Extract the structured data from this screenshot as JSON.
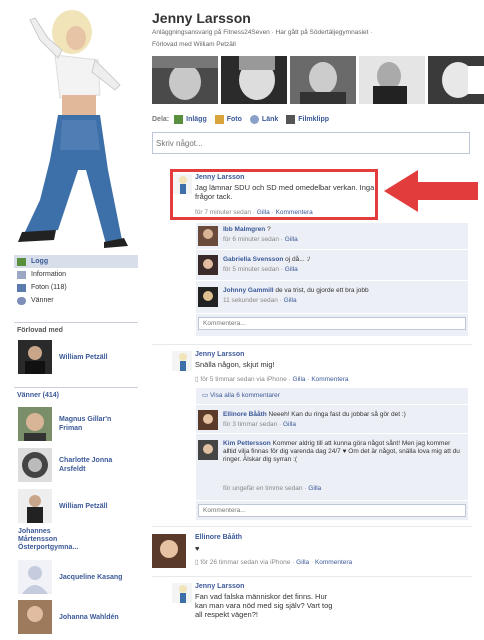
{
  "profile": {
    "name": "Jenny Larsson",
    "info_line": "Anläggningsansvarig på Fitness24Seven · Har gått på Södertäljegymnasiet ·",
    "engaged_line": "Förlovad med William Petzäll"
  },
  "nav": [
    {
      "label": "Logg",
      "icon": "wall-icon"
    },
    {
      "label": "Information",
      "icon": "info-icon"
    },
    {
      "label": "Foton (118)",
      "icon": "photos-icon"
    },
    {
      "label": "Vänner",
      "icon": "friends-icon"
    }
  ],
  "engaged_heading": "Förlovad med",
  "engaged_friend": "William Petzäll",
  "friends_heading": "Vänner (414)",
  "friends": [
    {
      "name": "Magnus Gillar'n Friman"
    },
    {
      "name": "Charlotte Jonna Arsfeldt"
    },
    {
      "name": "William Petzäll"
    },
    {
      "name": "Johannes Mårtensson Österportgymna..."
    },
    {
      "name": "Jacqueline Kasang"
    },
    {
      "name": "Johanna Wahldén"
    }
  ],
  "composer": {
    "label": "Dela:",
    "options": [
      "Inlägg",
      "Foto",
      "Länk",
      "Filmklipp"
    ],
    "placeholder": "Skriv något..."
  },
  "posts": [
    {
      "author": "Jenny Larsson",
      "text": "Jag lämnar SDU och SD med omedelbar verkan. Inga frågor tack.",
      "time": "för 7 minuter sedan · ",
      "actions": [
        "Gilla",
        "Kommentera"
      ],
      "comments": [
        {
          "name": "Ibb Malmgren",
          "text": "?",
          "time": "för 6 minuter sedan · ",
          "like": "Gilla"
        },
        {
          "name": "Gabriella Svensson",
          "text": "oj då... :/",
          "time": "för 5 minuter sedan · ",
          "like": "Gilla"
        },
        {
          "name": "Johnny Gammill",
          "text": "de va trist, du gjorde ett bra jobb",
          "time": "11 sekunder sedan · ",
          "like": "Gilla"
        }
      ],
      "write_placeholder": "Kommentera..."
    },
    {
      "author": "Jenny Larsson",
      "text": "Snälla någon, skjut mig!",
      "time": "för 5 timmar sedan via iPhone · ",
      "actions": [
        "Gilla",
        "Kommentera"
      ],
      "view_all": "Visa alla 6 kommentarer",
      "comments": [
        {
          "name": "Ellinore Bååth",
          "text": "Neeeh! Kan du ringa fast du jobbar så gör det :)",
          "time": "för 3 timmar sedan · ",
          "like": "Gilla"
        },
        {
          "name": "Kim Pettersson",
          "text": "Kommer aldrig till att kunna göra något sånt! Men jag kommer alltid vilja finnas för dig varenda dag 24/7 ♥ Om det är något, snälla lova mig att du ringer. Älskar dig syrran :(",
          "time": "för ungefär en timme sedan · ",
          "like": "Gilla"
        }
      ],
      "write_placeholder": "Kommentera..."
    },
    {
      "author": "Ellinore Bååth",
      "text": "♥",
      "time": "för 26 timmar sedan via iPhone · ",
      "actions": [
        "Gilla",
        "Kommentera"
      ]
    },
    {
      "author": "Jenny Larsson",
      "text": "Fan vad falska människor det finns. Hur kan man vara nöd med sig själv? Vart tog all respekt vägen?!",
      "time": "",
      "actions": []
    }
  ],
  "colors": {
    "link": "#3b5998",
    "highlight": "#e23c3c",
    "comment_bg": "#eceff5"
  }
}
